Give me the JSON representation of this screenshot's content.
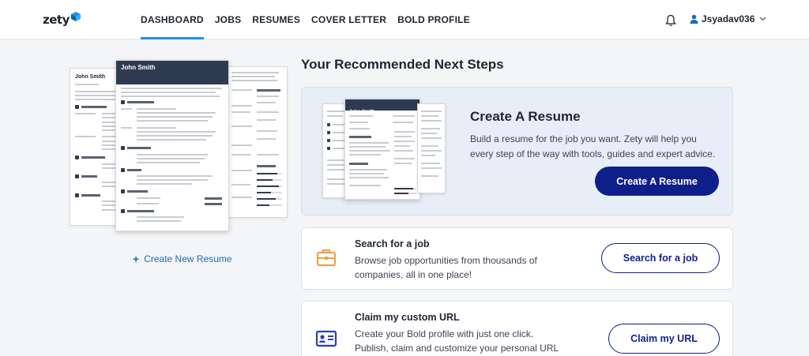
{
  "header": {
    "logo": "zety",
    "nav": [
      "DASHBOARD",
      "JOBS",
      "RESUMES",
      "COVER LETTER",
      "BOLD PROFILE"
    ],
    "active_nav": "DASHBOARD",
    "username": "Jsyadav036"
  },
  "preview": {
    "back_name": "John Smith",
    "front_name": "John Smith",
    "create_new_label": "Create New Resume"
  },
  "main": {
    "section_title": "Your Recommended Next Steps",
    "create_resume": {
      "title": "Create A Resume",
      "description": "Build a resume for the job you want. Zety will help you every step of the way with tools, guides and expert advice.",
      "button": "Create A Resume",
      "thumb_name": "John Smith"
    },
    "search_job": {
      "title": "Search for a job",
      "description": "Browse job opportunities from thousands of companies, all in one place!",
      "button": "Search for a job"
    },
    "custom_url": {
      "title": "Claim my custom URL",
      "description": "Create your Bold profile with just one click. Publish, claim and customize your personal URL to easily be",
      "button": "Claim my URL"
    }
  },
  "colors": {
    "accent": "#1a91f0",
    "primary_button": "#0e1f8a",
    "link": "#1a6bb8",
    "highlight_card": "#e8eef8",
    "icon_orange": "#f0a04b",
    "icon_blue": "#2b3fb8"
  }
}
